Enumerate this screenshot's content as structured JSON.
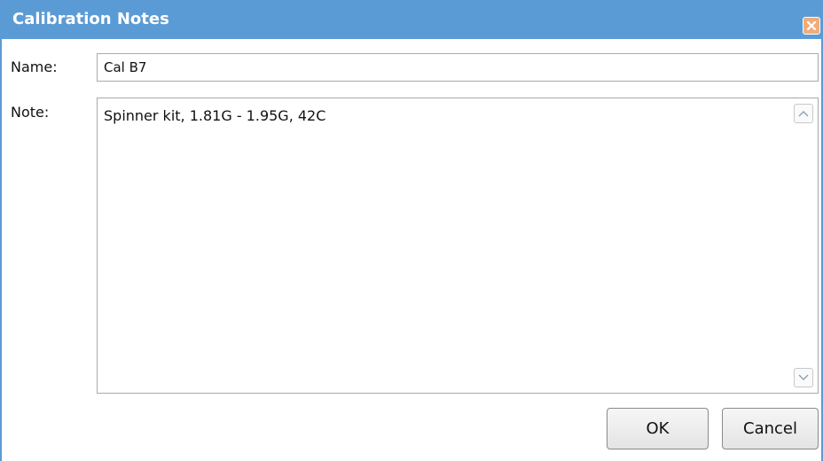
{
  "dialog": {
    "title": "Calibration Notes",
    "close_icon": "close-icon"
  },
  "form": {
    "name_label": "Name:",
    "name_value": "Cal B7",
    "note_label": "Note:",
    "note_value": "Spinner kit, 1.81G - 1.95G, 42C"
  },
  "buttons": {
    "ok_label": "OK",
    "cancel_label": "Cancel"
  },
  "colors": {
    "titlebar": "#5b9bd5",
    "close_button": "#f0ad7a"
  }
}
